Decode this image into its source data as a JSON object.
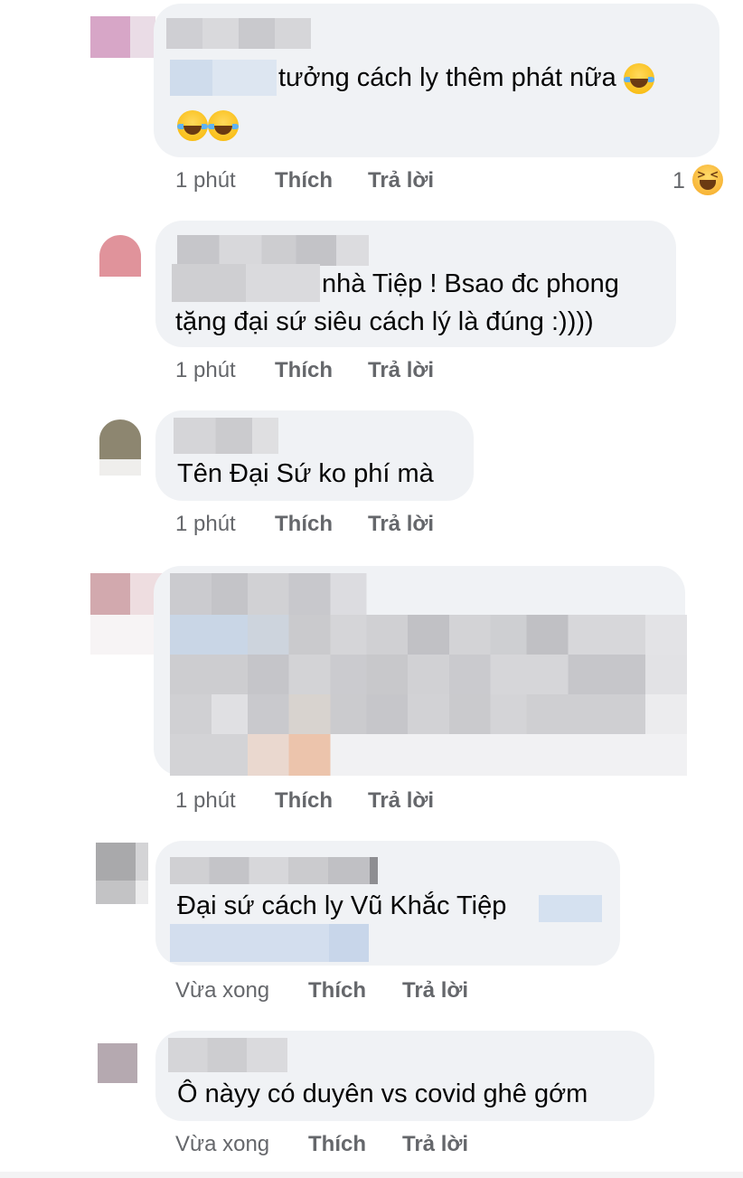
{
  "comments": [
    {
      "text_line1": "tưởng cách ly thêm phát nữa",
      "emoji_name": "tears-of-joy-emoji",
      "time": "1 phút",
      "like": "Thích",
      "reply": "Trả lời",
      "reaction_count": "1",
      "reaction_icon": "haha-reaction-icon"
    },
    {
      "text_line1": "nhà Tiệp ! Bsao đc phong",
      "text_line2": "tặng đại sứ siêu cách lý là đúng :))))",
      "time": "1 phút",
      "like": "Thích",
      "reply": "Trả lời"
    },
    {
      "text_line1": "Tên Đại Sứ ko phí mà",
      "time": "1 phút",
      "like": "Thích",
      "reply": "Trả lời"
    },
    {
      "time": "1 phút",
      "like": "Thích",
      "reply": "Trả lời"
    },
    {
      "text_line1": "Đại sứ cách ly Vũ Khắc Tiệp",
      "time": "Vừa xong",
      "like": "Thích",
      "reply": "Trả lời"
    },
    {
      "text_line1": "Ô nàyy có duyên vs covid ghê gớm",
      "time": "Vừa xong",
      "like": "Thích",
      "reply": "Trả lời"
    }
  ],
  "colors": {
    "bubble": "#f0f2f5",
    "meta_text": "#65676b",
    "body_text": "#050505"
  }
}
